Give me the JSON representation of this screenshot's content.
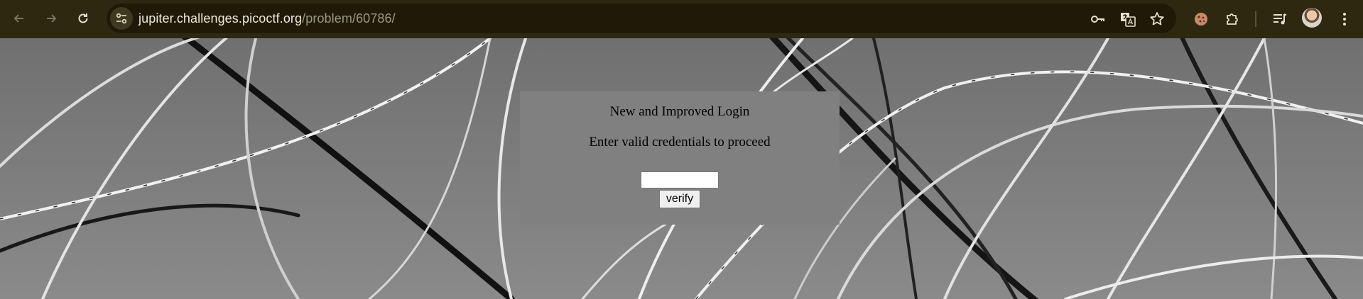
{
  "browser": {
    "url_host": "jupiter.challenges.picoctf.org",
    "url_path": "/problem/60786/",
    "icons": {
      "back": "arrow-left",
      "forward": "arrow-right",
      "reload": "reload",
      "site_info": "tune",
      "password": "key",
      "translate": "translate",
      "bookmark": "star",
      "extension": "cookie",
      "extensions": "puzzle",
      "media": "queue-music",
      "menu": "more-vert"
    },
    "colors": {
      "toolbar_bg": "#2e2810",
      "omnibox_bg": "#1f1a08"
    }
  },
  "login": {
    "title": "New and Improved Login",
    "subtitle": "Enter valid credentials to proceed",
    "input_value": "",
    "verify_label": "verify"
  }
}
